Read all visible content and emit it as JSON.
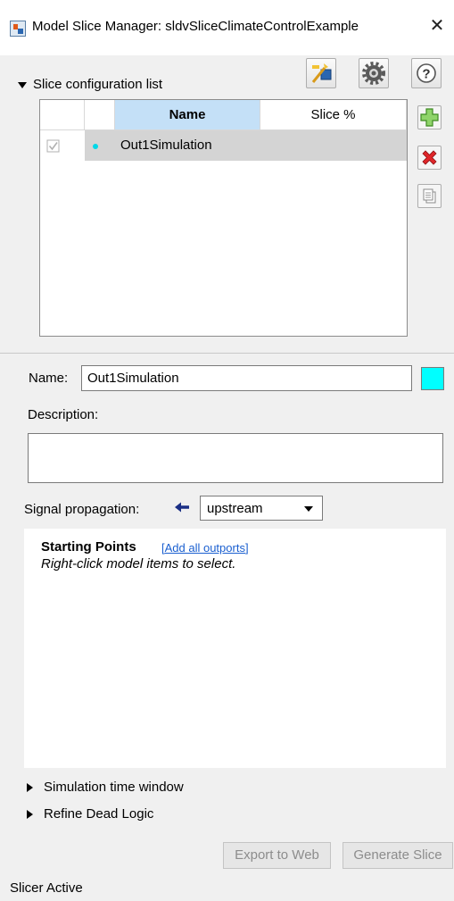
{
  "window": {
    "title": "Model Slice Manager: sldvSliceClimateControlExample",
    "close_glyph": "✕"
  },
  "toolbar": {
    "icons": [
      "highlight-icon",
      "gear-icon",
      "help-icon"
    ]
  },
  "slice_list": {
    "section_label": "Slice configuration list",
    "columns": [
      "",
      "",
      "Name",
      "Slice %"
    ],
    "rows": [
      {
        "checked": true,
        "color": "#00d8e8",
        "name": "Out1Simulation",
        "slice_percent": ""
      }
    ]
  },
  "side_buttons": [
    "add-icon",
    "delete-icon",
    "copy-icon"
  ],
  "form": {
    "name_label": "Name:",
    "name_value": "Out1Simulation",
    "swatch_color": "#00ffff",
    "description_label": "Description:",
    "description_value": "",
    "propagation_label": "Signal propagation:",
    "propagation_value": "upstream"
  },
  "starting_points": {
    "title": "Starting Points",
    "link": "[Add all outports]",
    "hint": "Right-click model items to select."
  },
  "expanders": {
    "simulation_window": "Simulation time window",
    "refine_dead_logic": "Refine Dead Logic"
  },
  "actions": {
    "export_label": "Export to Web",
    "generate_label": "Generate Slice"
  },
  "status": {
    "text": "Slicer Active"
  }
}
